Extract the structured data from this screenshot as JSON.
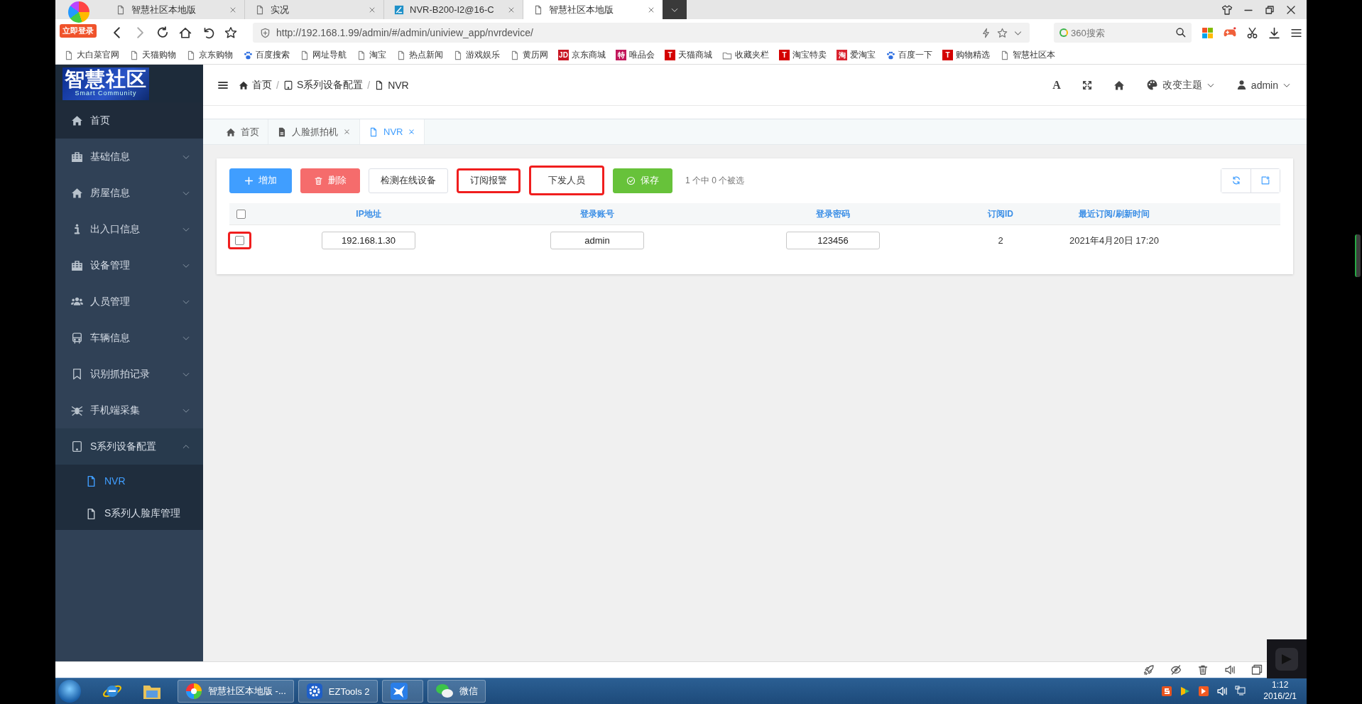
{
  "browser": {
    "login_badge": "立即登录",
    "tabs": [
      {
        "title": "智慧社区本地版",
        "kind": "page",
        "selected": false
      },
      {
        "title": "实况",
        "kind": "page",
        "selected": false
      },
      {
        "title": "NVR-B200-I2@16-C",
        "kind": "site",
        "selected": false
      },
      {
        "title": "智慧社区本地版",
        "kind": "page",
        "selected": true
      }
    ],
    "url": "http://192.168.1.99/admin/#/admin/uniview_app/nvrdevice/",
    "search": {
      "placeholder": "360搜索"
    },
    "bookmarks": [
      {
        "label": "大白菜官网",
        "kind": "page"
      },
      {
        "label": "天猫购物",
        "kind": "page"
      },
      {
        "label": "京东购物",
        "kind": "page"
      },
      {
        "label": "百度搜索",
        "kind": "paw"
      },
      {
        "label": "网址导航",
        "kind": "page"
      },
      {
        "label": "淘宝",
        "kind": "page"
      },
      {
        "label": "热点新闻",
        "kind": "page"
      },
      {
        "label": "游戏娱乐",
        "kind": "page"
      },
      {
        "label": "黄历网",
        "kind": "page"
      },
      {
        "label": "京东商城",
        "kind": "badge",
        "glyph": "JD",
        "color": "#c81623"
      },
      {
        "label": "唯品会",
        "kind": "badge",
        "glyph": "特",
        "color": "#c2185b"
      },
      {
        "label": "天猫商城",
        "kind": "badge",
        "glyph": "T",
        "color": "#d40000"
      },
      {
        "label": "收藏夹栏",
        "kind": "folder"
      },
      {
        "label": "淘宝特卖",
        "kind": "badge",
        "glyph": "T",
        "color": "#d40000"
      },
      {
        "label": "爱淘宝",
        "kind": "badge",
        "glyph": "淘",
        "color": "#d9232f"
      },
      {
        "label": "百度一下",
        "kind": "paw"
      },
      {
        "label": "购物精选",
        "kind": "badge",
        "glyph": "T",
        "color": "#d40000"
      },
      {
        "label": "智慧社区本",
        "kind": "page"
      }
    ]
  },
  "app": {
    "logo": {
      "title": "智慧社区",
      "subtitle": "Smart Community"
    },
    "sidebar": [
      {
        "label": "首页",
        "selected": true
      },
      {
        "label": "基础信息",
        "selected": false,
        "expanded": false
      },
      {
        "label": "房屋信息",
        "selected": false,
        "expanded": false
      },
      {
        "label": "出入口信息",
        "selected": false,
        "expanded": false
      },
      {
        "label": "设备管理",
        "selected": false,
        "expanded": false
      },
      {
        "label": "人员管理",
        "selected": false,
        "expanded": false
      },
      {
        "label": "车辆信息",
        "selected": false,
        "expanded": false
      },
      {
        "label": "识别抓拍记录",
        "selected": false,
        "expanded": false
      },
      {
        "label": "手机端采集",
        "selected": false,
        "expanded": false
      },
      {
        "label": "S系列设备配置",
        "selected": false,
        "expanded": true,
        "children": [
          {
            "label": "NVR",
            "selected": true
          },
          {
            "label": "S系列人脸库管理",
            "selected": false
          }
        ]
      }
    ],
    "breadcrumb": [
      {
        "label": "首页"
      },
      {
        "separator": "/",
        "label": "S系列设备配置"
      },
      {
        "separator": "/",
        "label": "NVR"
      }
    ],
    "header_tools": {
      "font_glyph": "A",
      "theme": "改变主题",
      "user": "admin"
    },
    "page_tabs": [
      {
        "label": "首页",
        "closable": false,
        "selected": false
      },
      {
        "label": "人脸抓拍机",
        "closable": true,
        "selected": false
      },
      {
        "label": "NVR",
        "closable": true,
        "selected": true
      }
    ],
    "toolbar": {
      "buttons": [
        {
          "label": "增加",
          "kind": "add",
          "highlighted": false
        },
        {
          "label": "删除",
          "kind": "delete",
          "highlighted": false
        },
        {
          "label": "检测在线设备",
          "kind": "plain",
          "highlighted": false
        },
        {
          "label": "订阅报警",
          "kind": "plain",
          "highlighted": true
        },
        {
          "label": "下发人员",
          "kind": "plain",
          "highlighted": true
        },
        {
          "label": "保存",
          "kind": "save",
          "highlighted": false
        }
      ],
      "selection_info": "1 个中 0 个被选"
    },
    "table": {
      "columns": [
        "IP地址",
        "登录账号",
        "登录密码",
        "订阅ID",
        "最近订阅/刷新时间"
      ],
      "header_checked": false,
      "rows": [
        {
          "checked": false,
          "highlighted": true,
          "ip": "192.168.1.30",
          "account": "admin",
          "password": "123456",
          "subscription_id": "2",
          "time": "2021年4月20日 17:20"
        }
      ]
    }
  },
  "taskbar": {
    "items": [
      {
        "kind": "pinned"
      },
      {
        "kind": "pinned"
      },
      {
        "kind": "task",
        "label": "智慧社区本地版 -..."
      },
      {
        "kind": "task",
        "label": "EZTools 2"
      },
      {
        "kind": "task"
      },
      {
        "kind": "task",
        "label": "微信"
      }
    ],
    "time": "1:12",
    "date": "2016/2/1"
  }
}
